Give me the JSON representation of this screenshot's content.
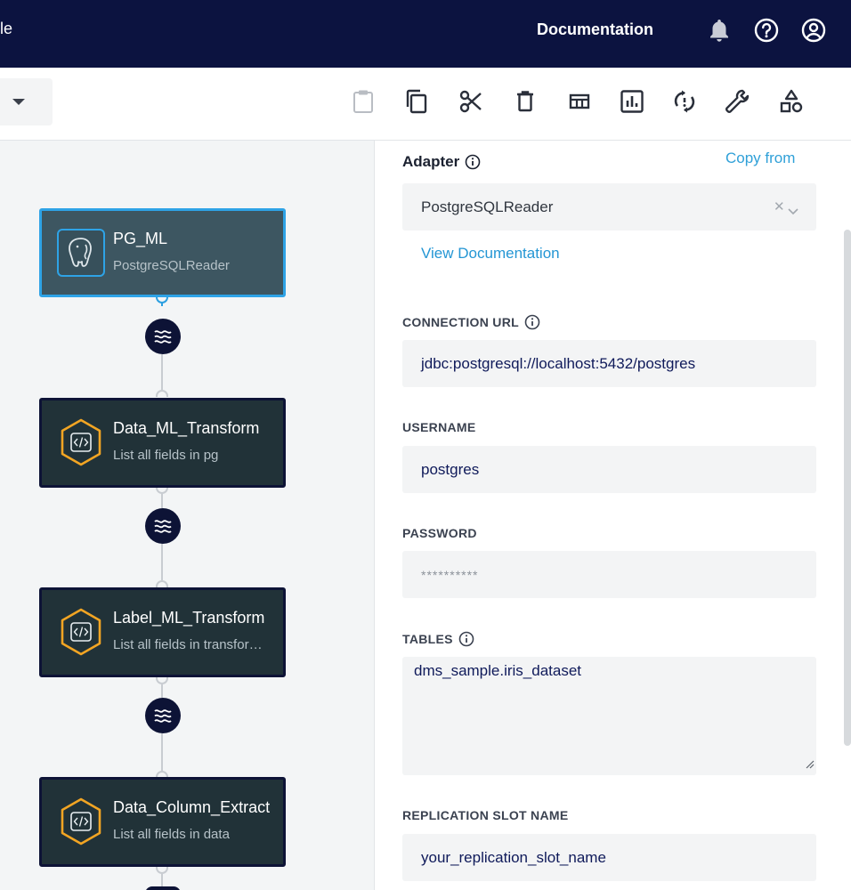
{
  "topbar": {
    "left_text": "le",
    "documentation_label": "Documentation",
    "icons": [
      "bell-icon",
      "help-icon",
      "user-account-icon"
    ],
    "background": "#0c1340"
  },
  "toolbar": {
    "tools": [
      "paste-icon",
      "copy-icon",
      "cut-icon",
      "delete-icon",
      "layout-icon",
      "chart-icon",
      "sync-alert-icon",
      "wrench-icon",
      "shapes-icon"
    ]
  },
  "flow": {
    "nodes": [
      {
        "title": "PG_ML",
        "subtitle": "PostgreSQLReader",
        "icon": "postgresql-elephant-icon",
        "selected": true
      },
      {
        "title": "Data_ML_Transform",
        "subtitle": "List all fields in pg",
        "icon": "code-hexagon-icon",
        "selected": false
      },
      {
        "title": "Label_ML_Transform",
        "subtitle": "List all fields in transfor…",
        "icon": "code-hexagon-icon",
        "selected": false
      },
      {
        "title": "Data_Column_Extract",
        "subtitle": "List all fields in data",
        "icon": "code-hexagon-icon",
        "selected": false
      }
    ],
    "stream_icon": "stream-waves-icon",
    "accent": "#2ea3e6",
    "transform_accent": "#f2a523"
  },
  "panel": {
    "adapter_label": "Adapter",
    "copy_from_label": "Copy from",
    "adapter_value": "PostgreSQLReader",
    "view_documentation_label": "View Documentation",
    "connection_url_label": "CONNECTION URL",
    "connection_url_value": "jdbc:postgresql://localhost:5432/postgres",
    "username_label": "USERNAME",
    "username_value": "postgres",
    "password_label": "PASSWORD",
    "password_value": "**********",
    "tables_label": "TABLES",
    "tables_value": "dms_sample.iris_dataset",
    "replication_slot_label": "REPLICATION SLOT NAME",
    "replication_slot_value": "your_replication_slot_name"
  }
}
